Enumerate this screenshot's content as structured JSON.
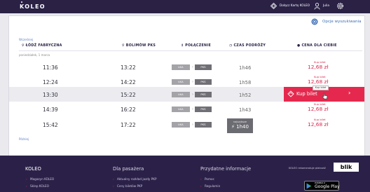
{
  "header": {
    "logo": "KOLEO",
    "add_card": "Dołącz Kartę KOLEO",
    "user": "Julia"
  },
  "options_link": "Opcje wyszukiwania",
  "earlier_link": "Wcześniej",
  "later_link": "Później",
  "columns": {
    "from": "ŁÓDŹ FABRYCZNA",
    "to": "BOLIMÓW PKS",
    "connection": "POŁĄCZENIE",
    "duration": "CZAS PODRÓŻY",
    "price": "CENA DLA CIEBIE"
  },
  "day_label": "poniedziałek, 1 marca",
  "price_label": "Kup bilet",
  "rows": [
    {
      "dep": "11:36",
      "arr": "13:22",
      "carrier_a": "ŁKA",
      "carrier_b": "PKS",
      "duration": "1h46",
      "price": "12,68 zł"
    },
    {
      "dep": "12:24",
      "arr": "14:22",
      "carrier_a": "ŁKA",
      "carrier_b": "PKS",
      "duration": "1h58",
      "price": "12,68 zł"
    },
    {
      "dep": "13:30",
      "arr": "15:22",
      "carrier_a": "ŁKA",
      "carrier_b": "PKS",
      "duration": "1h52",
      "price": "12,68 zł"
    },
    {
      "dep": "14:39",
      "arr": "16:22",
      "carrier_a": "ŁKA",
      "carrier_b": "PKS",
      "duration": "1h43",
      "price": "12,68 zł"
    },
    {
      "dep": "15:42",
      "arr": "17:22",
      "carrier_a": "ŁKA",
      "carrier_b": "PKS",
      "duration": "1h40",
      "price": "12,68 zł"
    }
  ],
  "transfer_label": "najszybsze",
  "buy_button": "Kup bilet",
  "buy_tooltip": "Kup bilet",
  "footer": {
    "koleo": "KOLEO",
    "col2_title": "Dla pasażera",
    "col3_title": "Przydatne informacje",
    "col1_links": [
      "Magazyn KOLEO",
      "Sklep KOLEO"
    ],
    "col2_links": [
      "Aktualny rozkład jazdy PKP",
      "Ceny biletów PKP"
    ],
    "col3_links": [
      "Pomoc",
      "Regulamin"
    ],
    "blik_text": "KOLEO rekomenduje płatność",
    "blik": "blik",
    "gplay_small": "POBIERZ Z",
    "gplay_big": "Google Play"
  },
  "colors": {
    "brand_dark": "#2a2145",
    "accent": "#e5294e",
    "price": "#d8294f",
    "link": "#3f6fb5"
  },
  "icons": [
    "diamond-icon",
    "user-icon",
    "gear-icon",
    "options-gear-icon",
    "train-icon",
    "bus-icon",
    "ticket-icon",
    "hand-cursor-icon",
    "google-play-icon"
  ]
}
